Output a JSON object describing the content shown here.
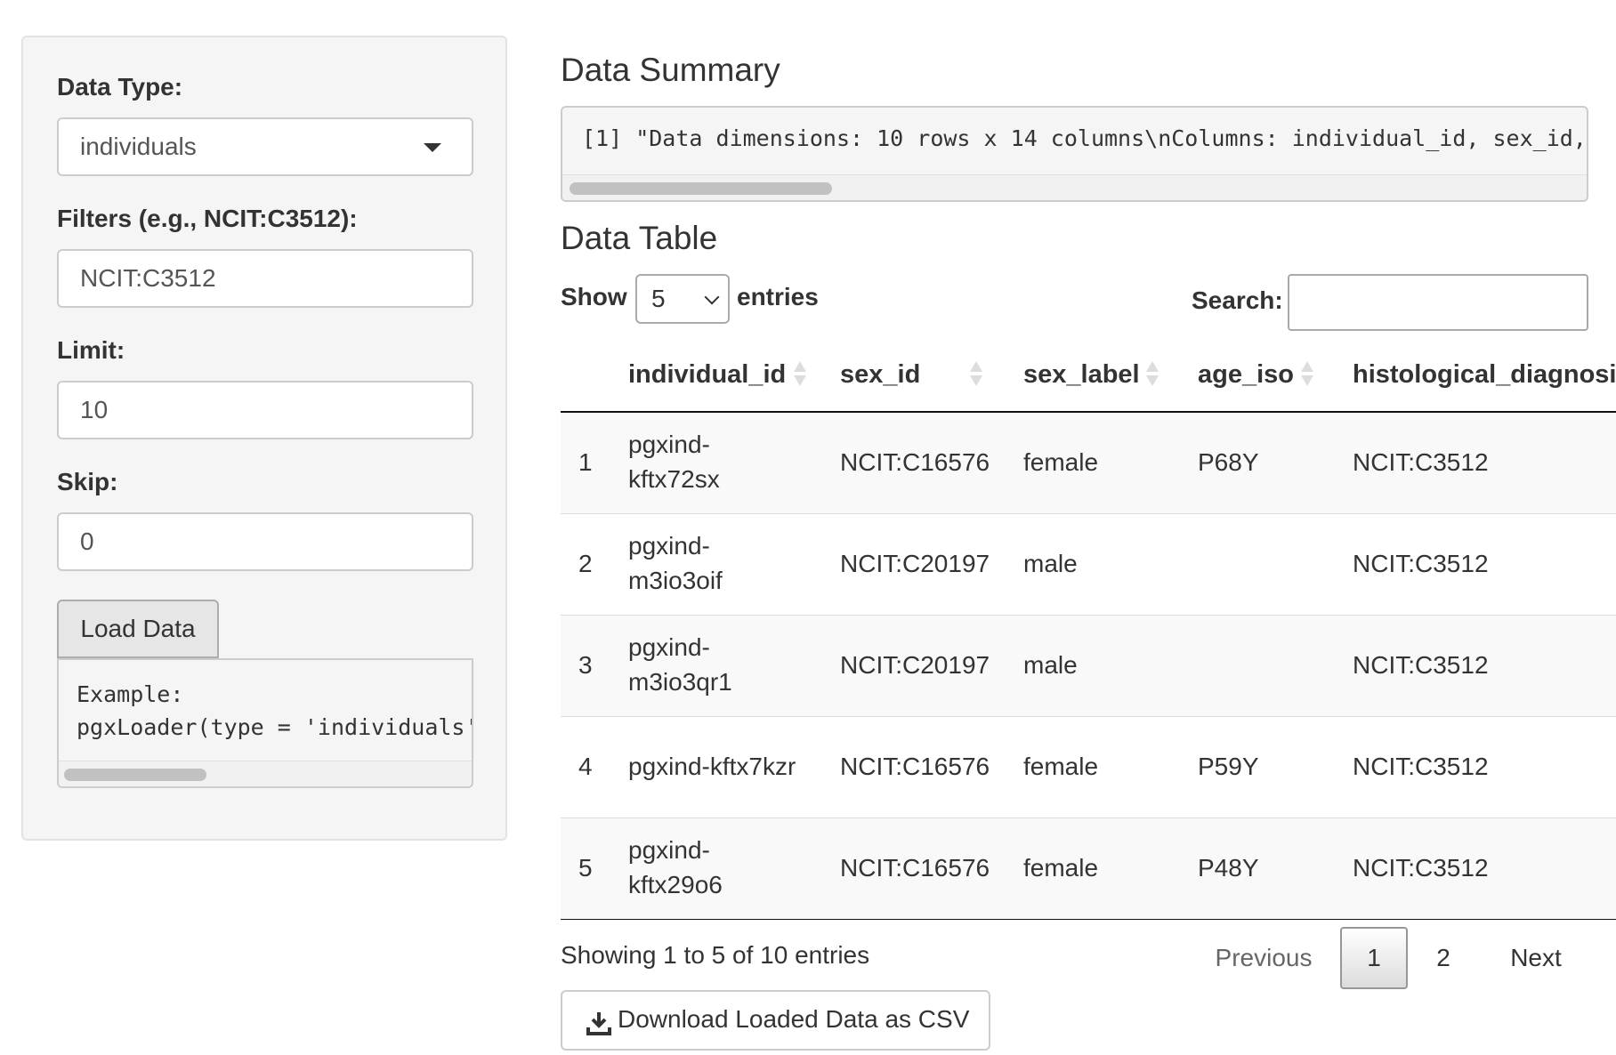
{
  "sidebar": {
    "data_type": {
      "label": "Data Type:",
      "value": "individuals"
    },
    "filters": {
      "label": "Filters (e.g., NCIT:C3512):",
      "value": "NCIT:C3512"
    },
    "limit": {
      "label": "Limit:",
      "value": "10"
    },
    "skip": {
      "label": "Skip:",
      "value": "0"
    },
    "load_button": "Load Data",
    "example_code": "Example:\npgxLoader(type = 'individuals'"
  },
  "main": {
    "summary_title": "Data Summary",
    "summary_text": "[1] \"Data dimensions: 10 rows x 14 columns\\nColumns: individual_id, sex_id, sex_label, age_iso, histological_diagnosis_id",
    "table_title": "Data Table",
    "length_menu": {
      "show": "Show",
      "value": "5",
      "entries": "entries"
    },
    "search_label": "Search:",
    "columns": [
      "individual_id",
      "sex_id",
      "sex_label",
      "age_iso",
      "histological_diagnosis"
    ],
    "rows": [
      {
        "num": "1",
        "individual_id": [
          "pgxind-",
          "kftx72sx"
        ],
        "sex_id": "NCIT:C16576",
        "sex_label": "female",
        "age_iso": "P68Y",
        "histological_diagnosis": "NCIT:C3512"
      },
      {
        "num": "2",
        "individual_id": [
          "pgxind-",
          "m3io3oif"
        ],
        "sex_id": "NCIT:C20197",
        "sex_label": "male",
        "age_iso": "",
        "histological_diagnosis": "NCIT:C3512"
      },
      {
        "num": "3",
        "individual_id": [
          "pgxind-",
          "m3io3qr1"
        ],
        "sex_id": "NCIT:C20197",
        "sex_label": "male",
        "age_iso": "",
        "histological_diagnosis": "NCIT:C3512"
      },
      {
        "num": "4",
        "individual_id": [
          "pgxind-kftx7kzr"
        ],
        "sex_id": "NCIT:C16576",
        "sex_label": "female",
        "age_iso": "P59Y",
        "histological_diagnosis": "NCIT:C3512"
      },
      {
        "num": "5",
        "individual_id": [
          "pgxind-",
          "kftx29o6"
        ],
        "sex_id": "NCIT:C16576",
        "sex_label": "female",
        "age_iso": "P48Y",
        "histological_diagnosis": "NCIT:C3512"
      }
    ],
    "info": "Showing 1 to 5 of 10 entries",
    "pagination": {
      "previous": "Previous",
      "pages": [
        "1",
        "2"
      ],
      "current": "1",
      "next": "Next"
    },
    "download_button": "Download Loaded Data as CSV"
  },
  "icons": {
    "select_caret": "caret-down-icon",
    "sort": "sort-both-icon",
    "download": "download-icon"
  }
}
